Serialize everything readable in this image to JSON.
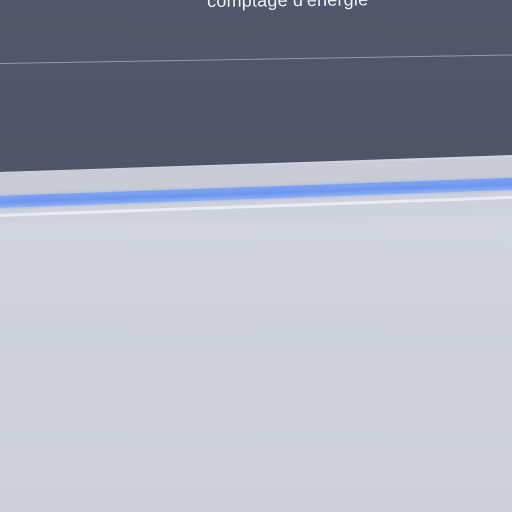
{
  "header": {
    "title": "comptage d'énergie"
  },
  "progress": {
    "value": 1.0
  },
  "colors": {
    "header_bg": "#525869",
    "accent": "#6d95ee",
    "content_bg": "#cfd2dc"
  }
}
